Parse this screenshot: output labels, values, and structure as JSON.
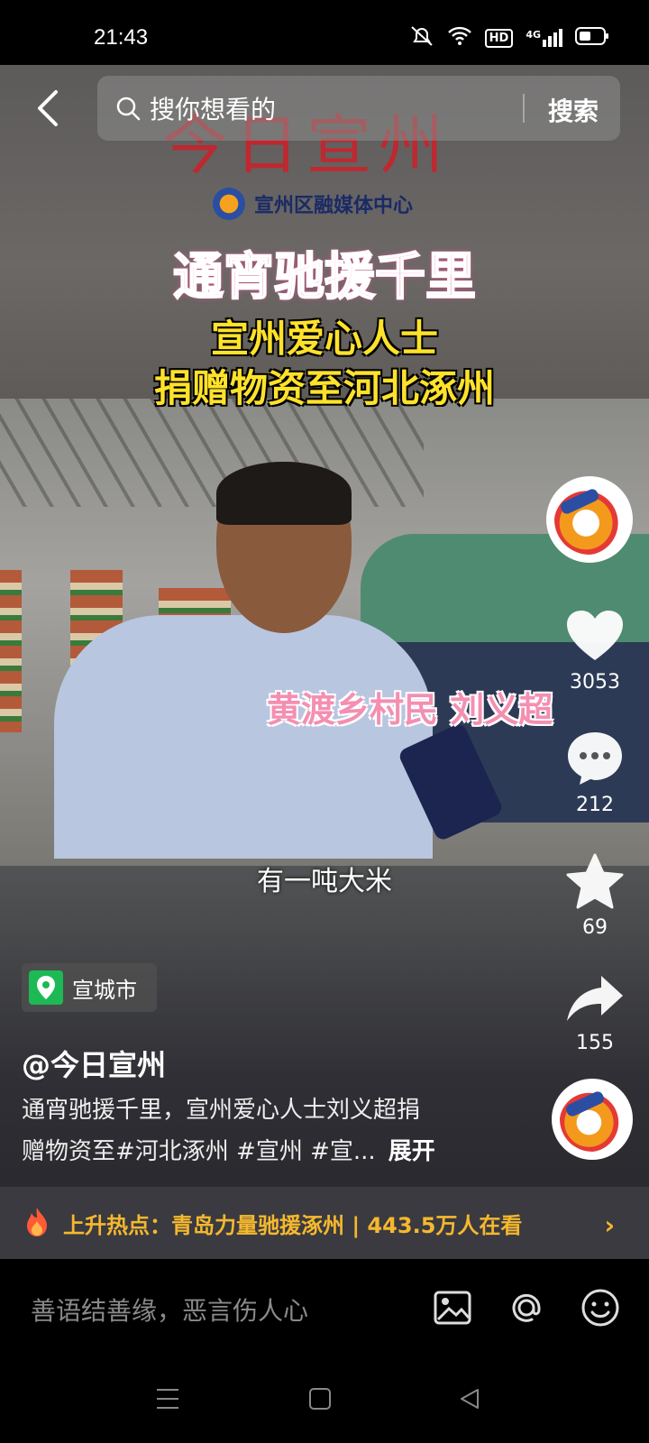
{
  "status_bar": {
    "time": "21:43",
    "icons": [
      "mute-icon",
      "wifi-icon",
      "hd-icon",
      "4g-signal-icon",
      "battery-icon"
    ],
    "hd_label": "HD",
    "net_label": "4G"
  },
  "search": {
    "placeholder": "搜你想看的",
    "button_label": "搜索"
  },
  "video": {
    "logo_title": "今日宣州",
    "org_name": "宣州区融媒体中心",
    "headline_1": "通宵驰援千里",
    "headline_2": "宣州爱心人士",
    "headline_3": "捐赠物资至河北涿州",
    "name_tag": "黄渡乡村民 刘义超",
    "subtitle": "有一吨大米"
  },
  "actions": {
    "likes": "3053",
    "comments": "212",
    "favorites": "69",
    "shares": "155"
  },
  "location": {
    "label": "宣城市"
  },
  "post": {
    "author": "@今日宣州",
    "description_line1": "通宵驰援千里，宣州爱心人士刘义超捐",
    "description_line2": "赠物资至#河北涿州 #宣州 #宣...",
    "expand_label": "展开"
  },
  "hot_topic": {
    "text": "上升热点：青岛力量驰援涿州 | 443.5万人在看"
  },
  "comment_box": {
    "placeholder": "善语结善缘，恶言伤人心"
  },
  "colors": {
    "accent": "#f5b82e",
    "location_pin": "#1db954",
    "headline_pink": "#f6a6c8",
    "headline_yellow": "#ffe22a"
  }
}
